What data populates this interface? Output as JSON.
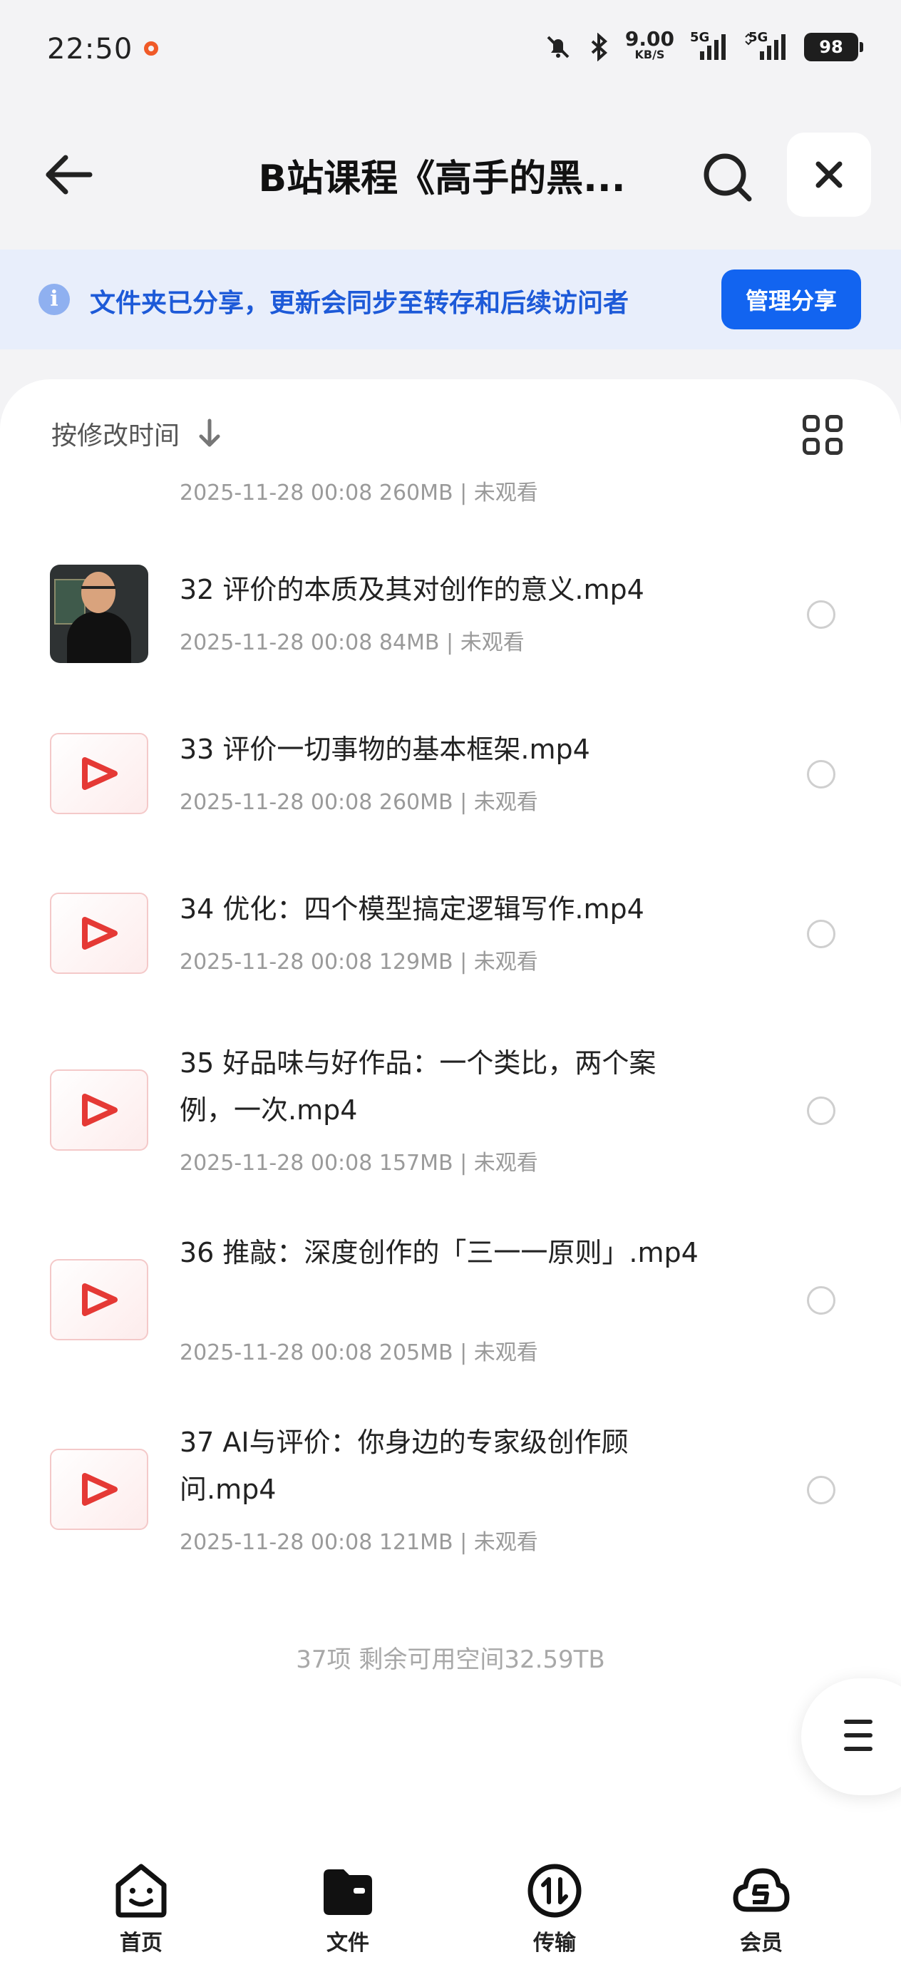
{
  "status_bar": {
    "time": "22:50",
    "net_speed": "9.00",
    "net_unit": "KB/S",
    "signal1": "5G",
    "signal2": "5G",
    "battery": "98"
  },
  "header": {
    "title": "B站课程《高手的黑...",
    "back_icon": "arrow-left-icon",
    "search_icon": "search-icon",
    "close_icon": "close-icon"
  },
  "share_banner": {
    "text": "文件夹已分享，更新会同步至转存和后续访问者",
    "button": "管理分享"
  },
  "sort": {
    "label": "按修改时间"
  },
  "files": [
    {
      "name": "",
      "meta": "2025-11-28 00:08  260MB | 未观看",
      "thumb": "photo"
    },
    {
      "name": "32 评价的本质及其对创作的意义.mp4",
      "meta": "2025-11-28 00:08  84MB | 未观看",
      "thumb": "photo"
    },
    {
      "name": "33 评价一切事物的基本框架.mp4",
      "meta": "2025-11-28 00:08  260MB | 未观看",
      "thumb": "video"
    },
    {
      "name": "34 优化：四个模型搞定逻辑写作.mp4",
      "meta": "2025-11-28 00:08  129MB | 未观看",
      "thumb": "video"
    },
    {
      "name": "35 好品味与好作品：一个类比，两个案例，一次.mp4",
      "meta": "2025-11-28 00:08  157MB | 未观看",
      "thumb": "video"
    },
    {
      "name": "36 推敲：深度创作的「三一一原则」.mp4",
      "meta": "2025-11-28 00:08  205MB | 未观看",
      "thumb": "video"
    },
    {
      "name": "37 AI与评价：你身边的专家级创作顾问.mp4",
      "meta": "2025-11-28 00:08  121MB | 未观看",
      "thumb": "video"
    }
  ],
  "footer": {
    "summary": "37项 剩余可用空间32.59TB"
  },
  "nav": {
    "home": "首页",
    "files": "文件",
    "transfer": "传输",
    "vip": "会员"
  },
  "colors": {
    "accent": "#1264f0",
    "banner_bg": "#e8eefb",
    "banner_text": "#1d5ad8",
    "play_red": "#e53935"
  }
}
